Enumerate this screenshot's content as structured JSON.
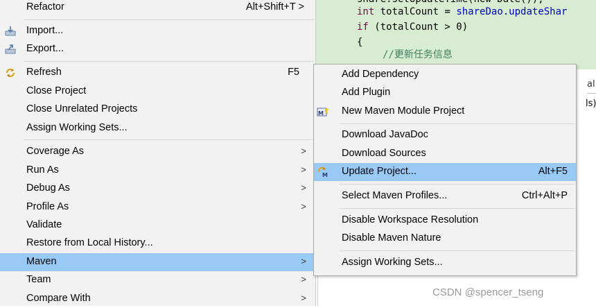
{
  "editor": {
    "line_fragment": "share.setUpdateTime(new Date());",
    "line2_kw": "int",
    "line2_rest": " totalCount = ",
    "line2_call": "shareDao.updateShar",
    "line3_kw": "if",
    "line3_rest": " (totalCount > 0)",
    "line4": "{",
    "line5_comment": "//更新任务信息"
  },
  "right_panel": {
    "tab1": "al",
    "tab2": "ls)"
  },
  "context_menu": {
    "refactor": {
      "label": "Refactor",
      "accel": "Alt+Shift+T >"
    },
    "import": {
      "label": "Import...",
      "icon": "import-icon"
    },
    "export": {
      "label": "Export...",
      "icon": "export-icon"
    },
    "refresh": {
      "label": "Refresh",
      "accel": "F5",
      "icon": "refresh-icon"
    },
    "close_project": "Close Project",
    "close_unrelated": "Close Unrelated Projects",
    "assign_sets": "Assign Working Sets...",
    "coverage_as": "Coverage As",
    "run_as": "Run As",
    "debug_as": "Debug As",
    "profile_as": "Profile As",
    "validate": "Validate",
    "restore_history": "Restore from Local History...",
    "maven": "Maven",
    "team": "Team",
    "compare_with": "Compare With",
    "arrow": ">"
  },
  "maven_menu": {
    "add_dependency": "Add Dependency",
    "add_plugin": "Add Plugin",
    "new_module": {
      "label": "New Maven Module Project",
      "icon": "maven-module-icon"
    },
    "download_javadoc": "Download JavaDoc",
    "download_sources": "Download Sources",
    "update_project": {
      "label": "Update Project...",
      "accel": "Alt+F5",
      "icon": "maven-update-icon"
    },
    "select_profiles": {
      "label": "Select Maven Profiles...",
      "accel": "Ctrl+Alt+P"
    },
    "disable_workspace": "Disable Workspace Resolution",
    "disable_nature": "Disable Maven Nature",
    "assign_sets": "Assign Working Sets..."
  },
  "colors": {
    "highlight": "#99c9f5",
    "menu_bg": "#f2f2f2",
    "editor_bg": "#d7ecd1"
  },
  "watermark": "CSDN @spencer_tseng"
}
